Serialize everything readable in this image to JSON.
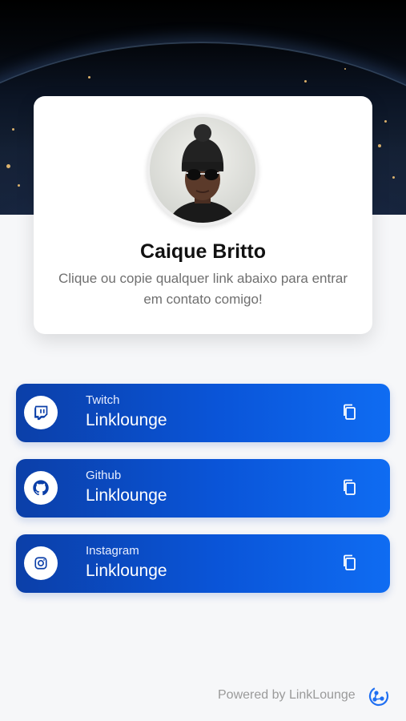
{
  "profile": {
    "name": "Caique Britto",
    "bio": "Clique ou copie qualquer link abaixo para entrar em contato comigo!",
    "avatar_icon": "avatar-portrait"
  },
  "links": [
    {
      "platform": "Twitch",
      "handle": "Linklounge",
      "icon": "twitch-icon",
      "action_icon": "copy-icon"
    },
    {
      "platform": "Github",
      "handle": "Linklounge",
      "icon": "github-icon",
      "action_icon": "copy-icon"
    },
    {
      "platform": "Instagram",
      "handle": "Linklounge",
      "icon": "instagram-icon",
      "action_icon": "copy-icon"
    }
  ],
  "footer": {
    "text": "Powered by LinkLounge",
    "logo_icon": "linklounge-logo-icon"
  },
  "colors": {
    "accent": "#0a55d9",
    "accent_dark": "#0b3fa8",
    "background": "#f6f7f9"
  }
}
